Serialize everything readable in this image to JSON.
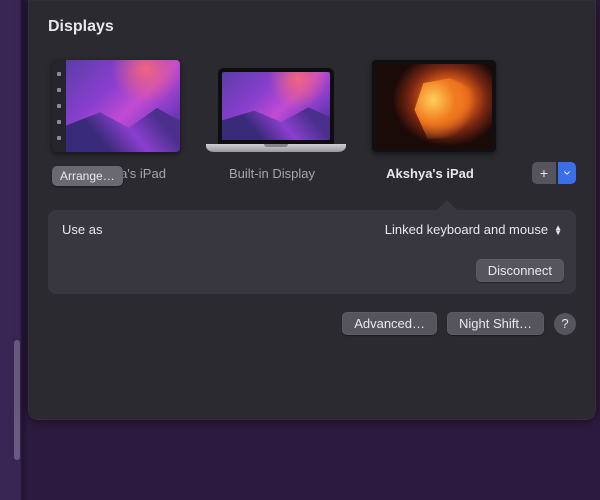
{
  "title": "Displays",
  "displays": [
    {
      "label": "a's iPad",
      "full_label": "Akshya's iPad",
      "selected": false
    },
    {
      "label": "Built-in Display",
      "selected": false
    },
    {
      "label": "Akshya's iPad",
      "selected": true
    }
  ],
  "arrange_button": "Arrange…",
  "add_display_button": "+",
  "settings": {
    "use_as_label": "Use as",
    "use_as_value": "Linked keyboard and mouse",
    "disconnect_button": "Disconnect"
  },
  "footer": {
    "advanced_button": "Advanced…",
    "night_shift_button": "Night Shift…",
    "help_button": "?"
  }
}
